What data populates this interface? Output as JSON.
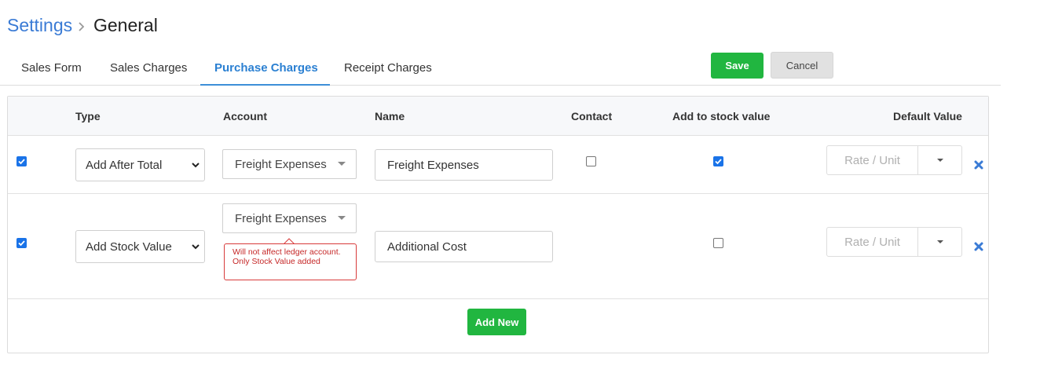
{
  "breadcrumb": {
    "root": "Settings",
    "separator_icon": "chevron-right-icon",
    "current": "General"
  },
  "tabs": [
    {
      "label": "Sales Form",
      "active": false
    },
    {
      "label": "Sales Charges",
      "active": false
    },
    {
      "label": "Purchase Charges",
      "active": true
    },
    {
      "label": "Receipt Charges",
      "active": false
    }
  ],
  "actions": {
    "save": "Save",
    "cancel": "Cancel"
  },
  "table": {
    "headers": {
      "type": "Type",
      "account": "Account",
      "name": "Name",
      "contact": "Contact",
      "stock": "Add to stock value",
      "default_value": "Default Value"
    },
    "rows": [
      {
        "enabled": true,
        "type": "Add After Total",
        "account": "Freight Expenses",
        "name": "Freight Expenses",
        "contact": false,
        "add_to_stock": true,
        "default_value_placeholder": "Rate / Unit"
      },
      {
        "enabled": true,
        "type": "Add Stock Value",
        "account": "Freight Expenses",
        "account_warning": "Will not affect ledger account. Only Stock Value added",
        "name": "Additional Cost",
        "add_to_stock": false,
        "default_value_placeholder": "Rate / Unit"
      }
    ],
    "add_new": "Add New"
  },
  "colors": {
    "accent": "#2b80d2",
    "save_green": "#21b640",
    "checkbox_blue": "#1a73e8",
    "remove_blue": "#3a7bd5",
    "warning_red": "#c62828"
  }
}
